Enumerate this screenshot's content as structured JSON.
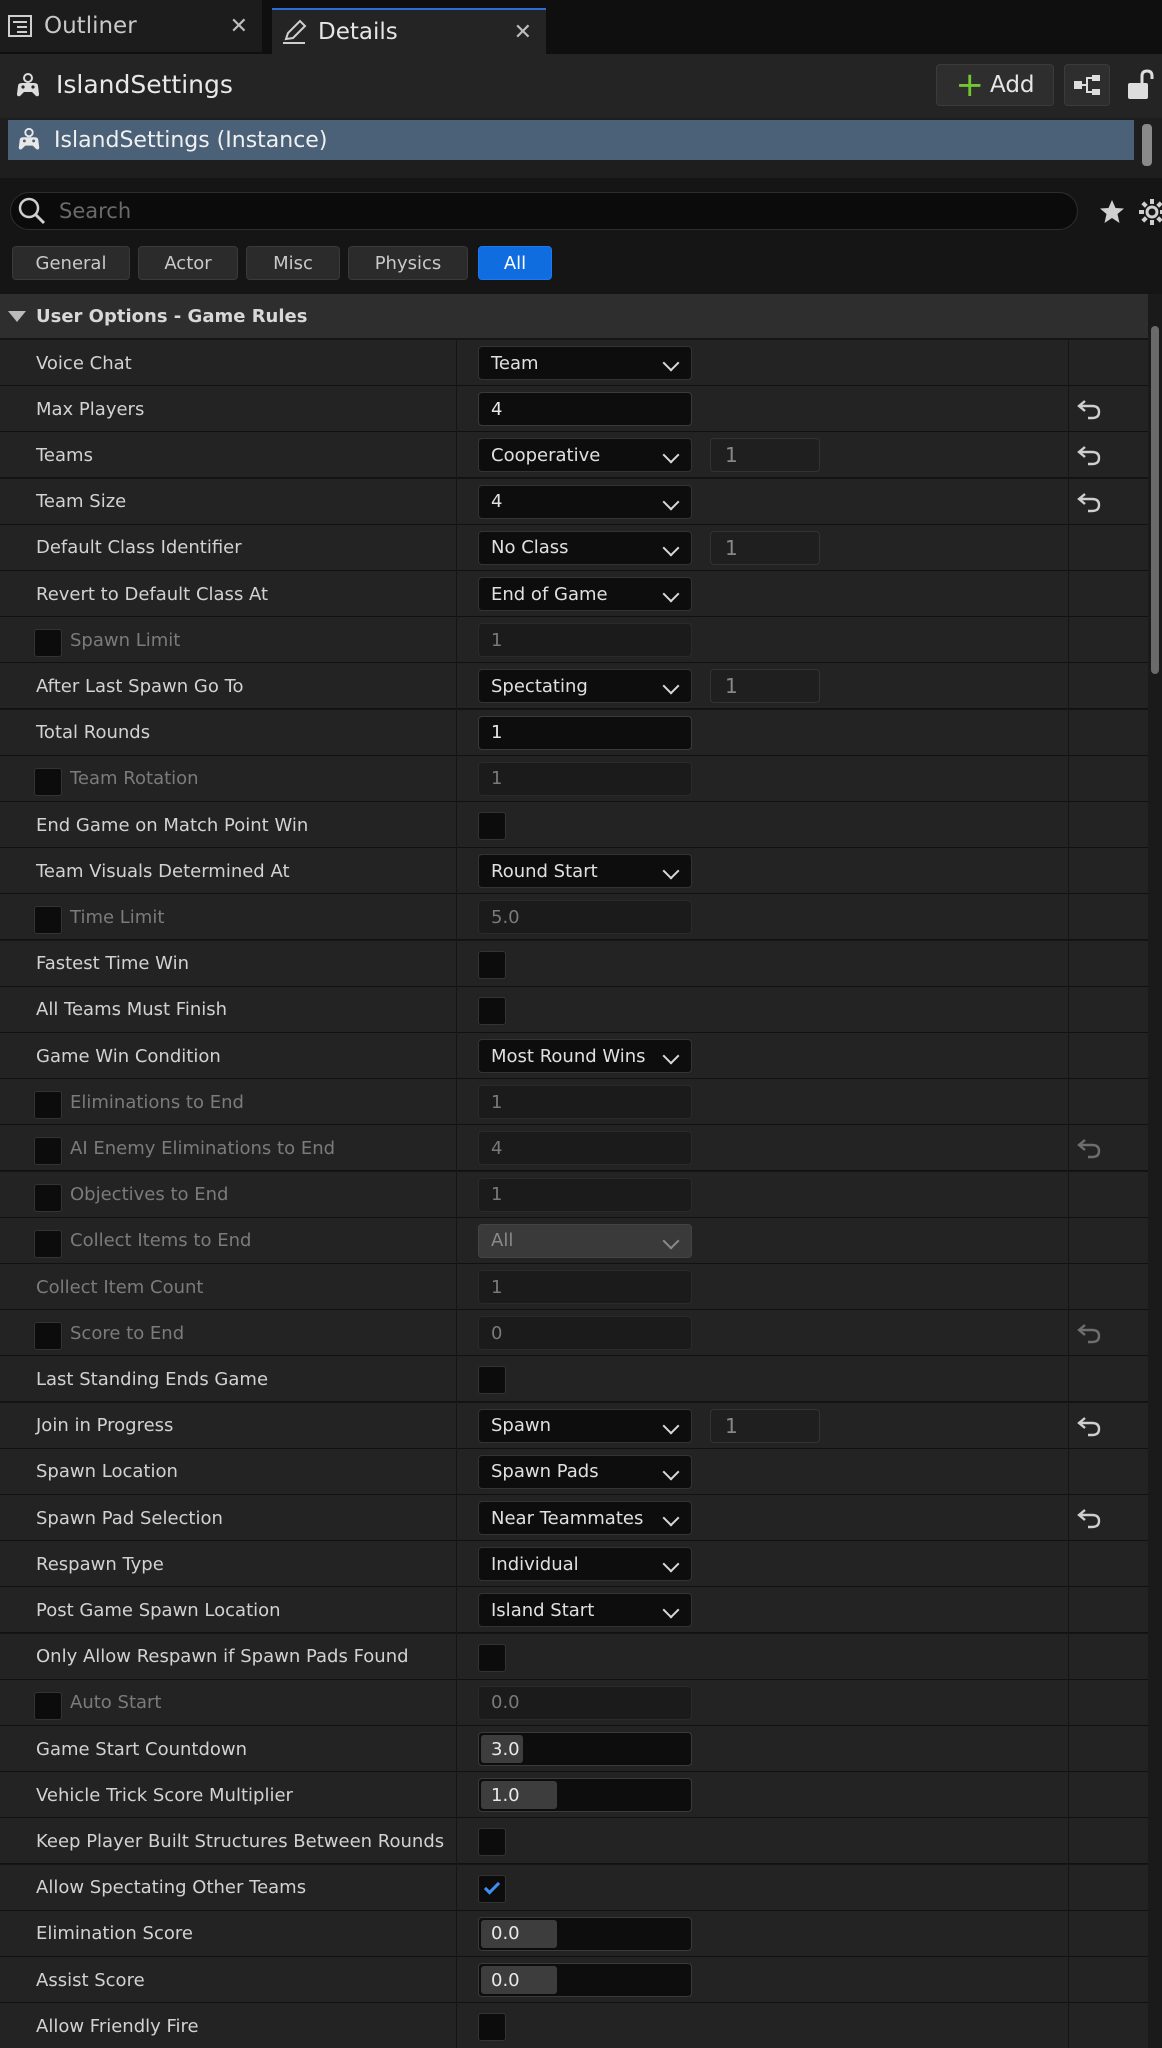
{
  "tabs": [
    {
      "label": "Outliner",
      "icon": "outliner-icon"
    },
    {
      "label": "Details",
      "icon": "details-edit-icon"
    }
  ],
  "header": {
    "actor_name": "IslandSettings",
    "add_label": "Add"
  },
  "instance": {
    "label": "IslandSettings (Instance)"
  },
  "search": {
    "placeholder": "Search"
  },
  "filters": [
    "General",
    "Actor",
    "Misc",
    "Physics",
    "All"
  ],
  "active_filter": "All",
  "category": {
    "label": "User Options - Game Rules"
  },
  "colors": {
    "accent": "#0f6de0",
    "selection": "#4a6178",
    "check": "#3d8ff3",
    "add_plus": "#73c534"
  },
  "properties": [
    {
      "name": "Voice Chat",
      "type": "dropdown",
      "value": "Team"
    },
    {
      "name": "Max Players",
      "type": "number",
      "value": "4",
      "reset": true
    },
    {
      "name": "Teams",
      "type": "dropdown",
      "value": "Cooperative",
      "index": "1",
      "reset": true
    },
    {
      "name": "Team Size",
      "type": "dropdown",
      "value": "4",
      "reset": true
    },
    {
      "name": "Default Class Identifier",
      "type": "dropdown",
      "value": "No Class",
      "index": "1"
    },
    {
      "name": "Revert to Default Class At",
      "type": "dropdown",
      "value": "End of Game"
    },
    {
      "name": "Spawn Limit",
      "type": "number",
      "value": "1",
      "override": true,
      "disabled": true
    },
    {
      "name": "After Last Spawn Go To",
      "type": "dropdown",
      "value": "Spectating",
      "index": "1"
    },
    {
      "name": "Total Rounds",
      "type": "number",
      "value": "1"
    },
    {
      "name": "Team Rotation",
      "type": "number",
      "value": "1",
      "override": true,
      "disabled": true
    },
    {
      "name": "End Game on Match Point Win",
      "type": "checkbox",
      "checked": false
    },
    {
      "name": "Team Visuals Determined At",
      "type": "dropdown",
      "value": "Round Start"
    },
    {
      "name": "Time Limit",
      "type": "number",
      "value": "5.0",
      "override": true,
      "disabled": true
    },
    {
      "name": "Fastest Time Win",
      "type": "checkbox",
      "checked": false
    },
    {
      "name": "All Teams Must Finish",
      "type": "checkbox",
      "checked": false
    },
    {
      "name": "Game Win Condition",
      "type": "dropdown",
      "value": "Most Round Wins"
    },
    {
      "name": "Eliminations to End",
      "type": "number",
      "value": "1",
      "override": true,
      "disabled": true
    },
    {
      "name": "AI Enemy Eliminations to End",
      "type": "number",
      "value": "4",
      "override": true,
      "disabled": true,
      "reset": true
    },
    {
      "name": "Objectives to End",
      "type": "number",
      "value": "1",
      "override": true,
      "disabled": true
    },
    {
      "name": "Collect Items to End",
      "type": "dropdown",
      "value": "All",
      "override": true,
      "disabled": true
    },
    {
      "name": "Collect Item Count",
      "type": "number",
      "value": "1",
      "disabled": true
    },
    {
      "name": "Score to End",
      "type": "number",
      "value": "0",
      "override": true,
      "disabled": true,
      "reset": true
    },
    {
      "name": "Last Standing Ends Game",
      "type": "checkbox",
      "checked": false
    },
    {
      "name": "Join in Progress",
      "type": "dropdown",
      "value": "Spawn",
      "index": "1",
      "reset": true
    },
    {
      "name": "Spawn Location",
      "type": "dropdown",
      "value": "Spawn Pads"
    },
    {
      "name": "Spawn Pad Selection",
      "type": "dropdown",
      "value": "Near Teammates",
      "reset": true
    },
    {
      "name": "Respawn Type",
      "type": "dropdown",
      "value": "Individual"
    },
    {
      "name": "Post Game Spawn Location",
      "type": "dropdown",
      "value": "Island Start"
    },
    {
      "name": "Only Allow Respawn if Spawn Pads Found",
      "type": "checkbox",
      "checked": false
    },
    {
      "name": "Auto Start",
      "type": "number",
      "value": "0.0",
      "override": true,
      "disabled": true
    },
    {
      "name": "Game Start Countdown",
      "type": "slider",
      "value": "3.0",
      "fill": 0.2
    },
    {
      "name": "Vehicle Trick Score Multiplier",
      "type": "slider",
      "value": "1.0",
      "fill": 0.36
    },
    {
      "name": "Keep Player Built Structures Between Rounds",
      "type": "checkbox",
      "checked": false
    },
    {
      "name": "Allow Spectating Other Teams",
      "type": "checkbox",
      "checked": true
    },
    {
      "name": "Elimination Score",
      "type": "slider",
      "value": "0.0",
      "fill": 0.36
    },
    {
      "name": "Assist Score",
      "type": "slider",
      "value": "0.0",
      "fill": 0.36
    },
    {
      "name": "Allow Friendly Fire",
      "type": "checkbox",
      "checked": false
    }
  ]
}
